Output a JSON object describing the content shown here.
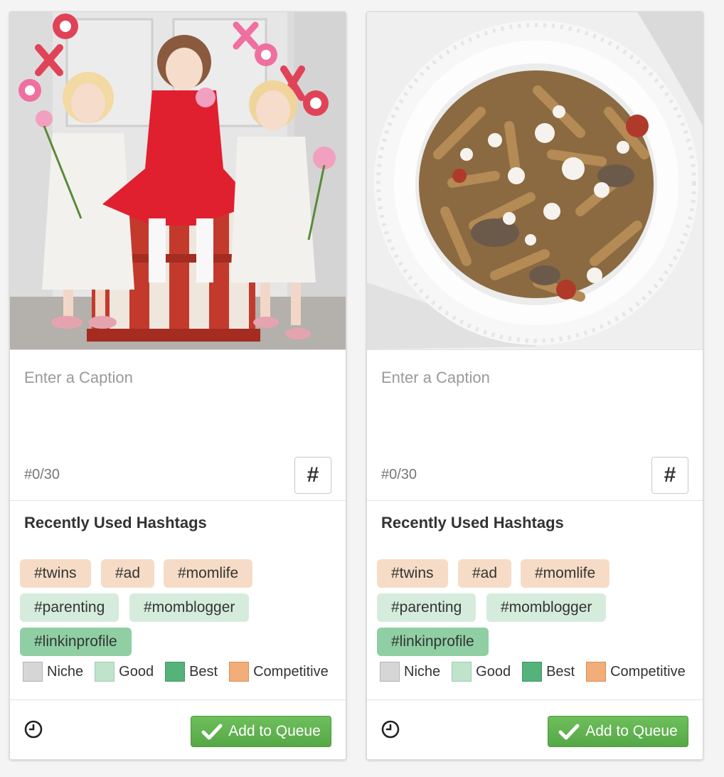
{
  "colors": {
    "competitive": "#f6dcc6",
    "good": "#d5ecdd",
    "best": "#8fcfa3",
    "accent_green": "#5cb24b"
  },
  "cards": [
    {
      "image": "three-girls-valentine-photo",
      "caption_placeholder": "Enter a Caption",
      "hashtag_count": "#0/30",
      "hashtag_button": "#",
      "hashtags_title": "Recently Used Hashtags",
      "tags": [
        {
          "text": "#twins",
          "level": "competitive"
        },
        {
          "text": "#ad",
          "level": "competitive"
        },
        {
          "text": "#momlife",
          "level": "competitive"
        },
        {
          "text": "#parenting",
          "level": "good"
        },
        {
          "text": "#momblogger",
          "level": "good"
        },
        {
          "text": "#linkinprofile",
          "level": "best"
        }
      ],
      "legend": [
        "Niche",
        "Good",
        "Best",
        "Competitive"
      ],
      "add_button": "Add to Queue",
      "schedule_icon": "clock-icon"
    },
    {
      "image": "pasta-bowl-photo",
      "caption_placeholder": "Enter a Caption",
      "hashtag_count": "#0/30",
      "hashtag_button": "#",
      "hashtags_title": "Recently Used Hashtags",
      "tags": [
        {
          "text": "#twins",
          "level": "competitive"
        },
        {
          "text": "#ad",
          "level": "competitive"
        },
        {
          "text": "#momlife",
          "level": "competitive"
        },
        {
          "text": "#parenting",
          "level": "good"
        },
        {
          "text": "#momblogger",
          "level": "good"
        },
        {
          "text": "#linkinprofile",
          "level": "best"
        }
      ],
      "legend": [
        "Niche",
        "Good",
        "Best",
        "Competitive"
      ],
      "add_button": "Add to Queue",
      "schedule_icon": "clock-icon"
    }
  ]
}
